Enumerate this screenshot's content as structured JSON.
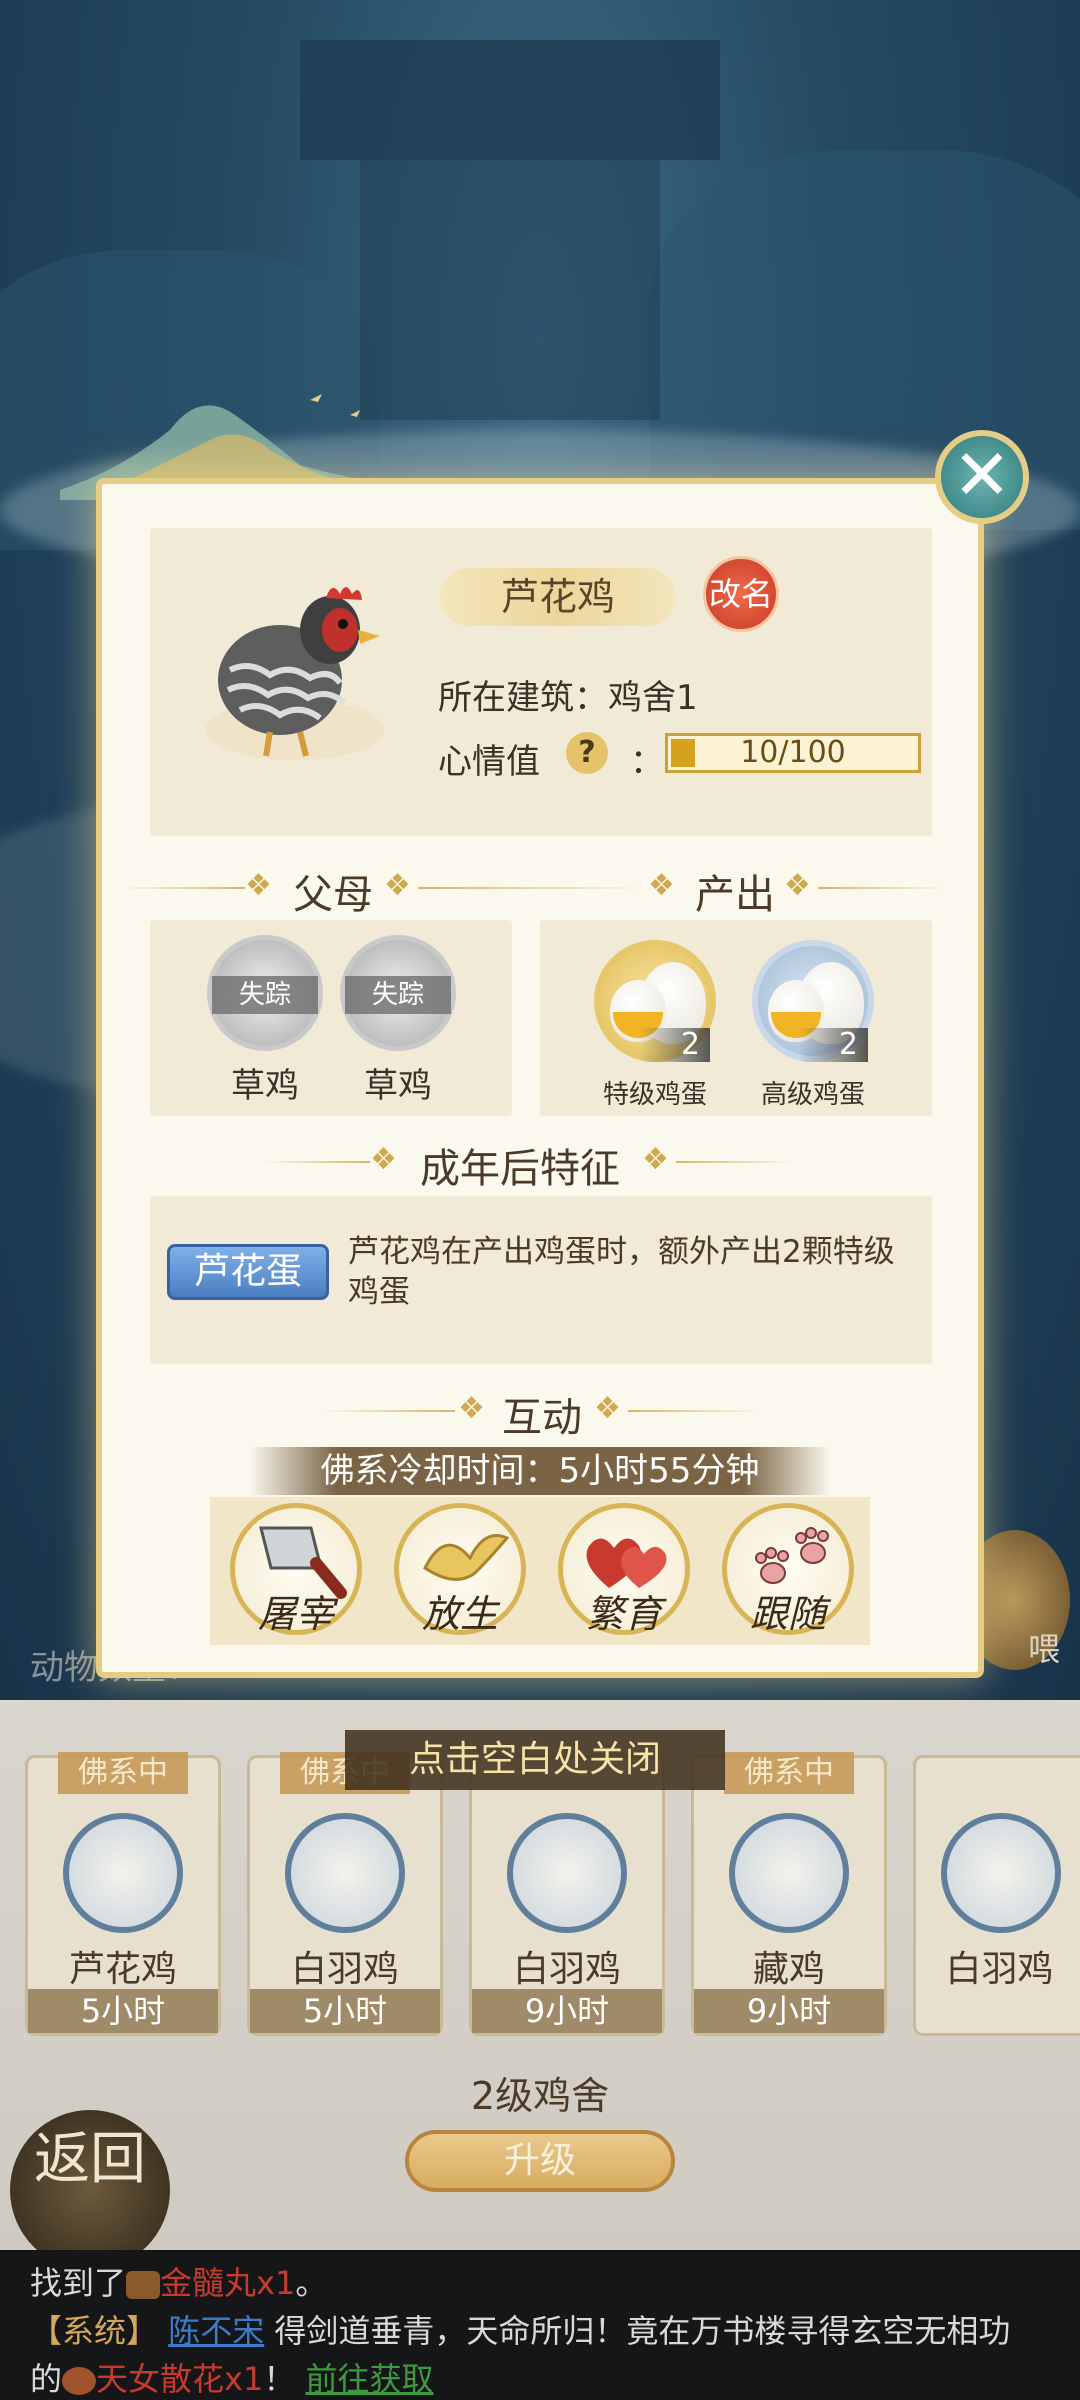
{
  "dialog": {
    "chicken_name": "芦花鸡",
    "rename_label": "改名",
    "building_line": "所在建筑：鸡舍1",
    "mood_label": "心情值",
    "mood_help": "?",
    "mood_colon": "：",
    "mood_text": "10/100",
    "mood_value": 10,
    "mood_max": 100,
    "close_icon": "close-icon",
    "sections": {
      "parents": "父母",
      "output": "产出",
      "traits": "成年后特征",
      "interact": "互动"
    },
    "parents": [
      {
        "status": "失踪",
        "name": "草鸡"
      },
      {
        "status": "失踪",
        "name": "草鸡"
      }
    ],
    "outputs": [
      {
        "name": "特级鸡蛋",
        "count": "2"
      },
      {
        "name": "高级鸡蛋",
        "count": "2"
      }
    ],
    "trait": {
      "badge": "芦花蛋",
      "description": "芦花鸡在产出鸡蛋时，额外产出2颗特级鸡蛋"
    },
    "cooldown": "佛系冷却时间：5小时55分钟",
    "actions": [
      {
        "label": "屠宰",
        "icon": "cleaver-icon"
      },
      {
        "label": "放生",
        "icon": "bird-icon"
      },
      {
        "label": "繁育",
        "icon": "hearts-icon"
      },
      {
        "label": "跟随",
        "icon": "pawprints-icon"
      }
    ]
  },
  "close_hint": "点击空白处关闭",
  "coop": {
    "count_label": "动物数量：",
    "cards": [
      {
        "badge": "佛系中",
        "name": "芦花鸡",
        "time": "5小时"
      },
      {
        "badge": "佛系中",
        "name": "白羽鸡",
        "time": "5小时"
      },
      {
        "badge": "",
        "name": "白羽鸡",
        "time": "9小时"
      },
      {
        "badge": "佛系中",
        "name": "藏鸡",
        "time": "9小时"
      },
      {
        "badge": "",
        "name": "白羽鸡",
        "time": ""
      }
    ],
    "level": "2级鸡舍",
    "upgrade": "升级",
    "back": "返回",
    "feed": "喂"
  },
  "chat": {
    "line1_prefix": "找到了",
    "line1_item": "金髓丸x1",
    "line1_suffix": "。",
    "line2_tag": "【系统】",
    "line2_player": "陈不宋",
    "line2_text": "得剑道垂青，天命所归！竟在万书楼寻得玄空无相功",
    "line3_prefix": "的",
    "line3_item": "天女散花x1",
    "line3_mid": "！",
    "line3_link": "前往获取"
  }
}
